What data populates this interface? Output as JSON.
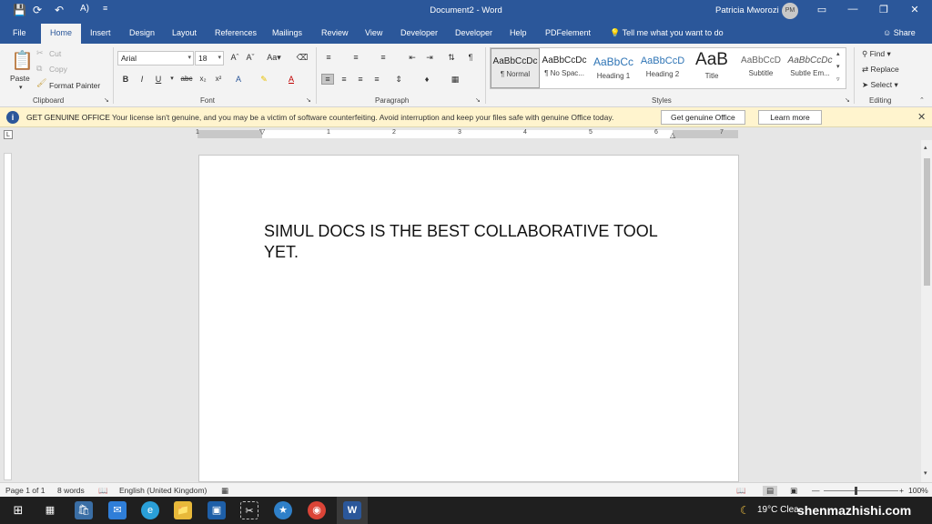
{
  "titlebar": {
    "document_title": "Document2 - Word",
    "user_name": "Patricia Mworozi",
    "user_initials": "PM"
  },
  "tabs": [
    {
      "label": "File"
    },
    {
      "label": "Home"
    },
    {
      "label": "Insert"
    },
    {
      "label": "Design"
    },
    {
      "label": "Layout"
    },
    {
      "label": "References"
    },
    {
      "label": "Mailings"
    },
    {
      "label": "Review"
    },
    {
      "label": "View"
    },
    {
      "label": "Developer"
    },
    {
      "label": "Developer"
    },
    {
      "label": "Help"
    },
    {
      "label": "PDFelement"
    }
  ],
  "tell_me": "Tell me what you want to do",
  "share": "Share",
  "clipboard": {
    "paste": "Paste",
    "cut": "Cut",
    "copy": "Copy",
    "format_painter": "Format Painter",
    "group_label": "Clipboard"
  },
  "font": {
    "family": "Arial",
    "size": "18",
    "group_label": "Font"
  },
  "paragraph": {
    "group_label": "Paragraph"
  },
  "styles": {
    "group_label": "Styles",
    "items": [
      {
        "sample": "AaBbCcDc",
        "name": "¶ Normal"
      },
      {
        "sample": "AaBbCcDc",
        "name": "¶ No Spac..."
      },
      {
        "sample": "AaBbCc",
        "name": "Heading 1"
      },
      {
        "sample": "AaBbCcD",
        "name": "Heading 2"
      },
      {
        "sample": "AaB",
        "name": "Title"
      },
      {
        "sample": "AaBbCcD",
        "name": "Subtitle"
      },
      {
        "sample": "AaBbCcDc",
        "name": "Subtle Em..."
      }
    ]
  },
  "editing": {
    "find": "Find",
    "replace": "Replace",
    "select": "Select",
    "group_label": "Editing"
  },
  "notification": {
    "title": "GET GENUINE OFFICE",
    "message": "Your license isn't genuine, and you may be a victim of software counterfeiting. Avoid interruption and keep your files safe with genuine Office today.",
    "primary_button": "Get genuine Office",
    "secondary_button": "Learn more"
  },
  "ruler_numbers": [
    "1",
    "1",
    "2",
    "3",
    "4",
    "5",
    "6",
    "7"
  ],
  "document": {
    "body_text": "SIMUL DOCS IS THE BEST COLLABORATIVE TOOL YET."
  },
  "status": {
    "page": "Page 1 of 1",
    "words": "8 words",
    "language": "English (United Kingdom)",
    "zoom": "100%"
  },
  "taskbar": {
    "temperature": "19°C",
    "weather": "Clea",
    "watermark": "shenmazhishi.com"
  },
  "colors": {
    "word_blue": "#2b579a",
    "notification_bg": "#fff4ce"
  }
}
